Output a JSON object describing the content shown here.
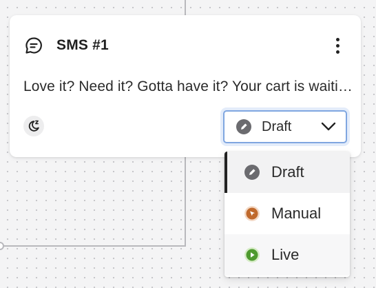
{
  "card": {
    "title": "SMS #1",
    "message": "Love it? Need it? Gotta have it? Your cart is waiting for you!",
    "title_icon": "chat-bubble-icon",
    "snooze_icon": "moon-snooze-icon",
    "menu_icon": "kebab-icon"
  },
  "status_select": {
    "selected": "Draft",
    "icon": "pencil-icon",
    "chevron": "chevron-down-icon"
  },
  "status_menu": {
    "options": [
      {
        "label": "Draft",
        "icon": "pencil-icon",
        "color": "#6b6b6f",
        "selected": true
      },
      {
        "label": "Manual",
        "icon": "cursor-icon",
        "color": "#c0692c",
        "selected": false
      },
      {
        "label": "Live",
        "icon": "play-icon",
        "color": "#4e9a2f",
        "selected": false
      }
    ]
  },
  "colors": {
    "focus_border": "#7fa6e0",
    "canvas": "#f4f4f5",
    "connector": "#b8b8bc"
  }
}
